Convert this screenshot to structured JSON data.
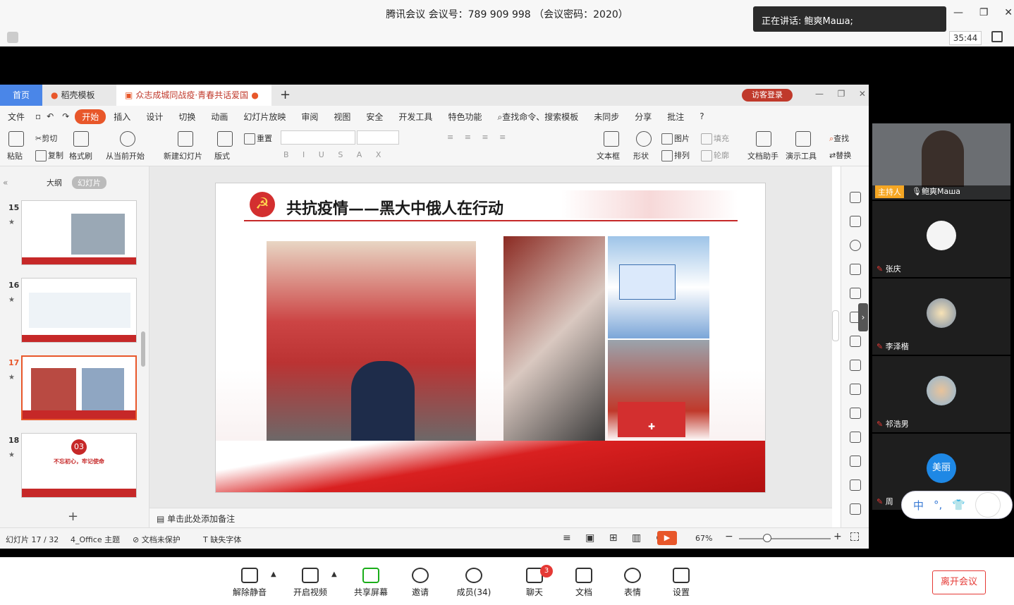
{
  "meeting": {
    "title": "腾讯会议 会议号：789 909 998 （会议密码：2020）",
    "speaking": "正在讲话: 鲍爽Маша;",
    "timer": "35:44"
  },
  "wps": {
    "tabs": [
      "首页",
      "稻壳模板",
      "众志成城同战疫·青春共话爱国情"
    ],
    "visitor": "访客登录",
    "menu": [
      "文件",
      "开始",
      "插入",
      "设计",
      "切换",
      "动画",
      "幻灯片放映",
      "审阅",
      "视图",
      "安全",
      "开发工具",
      "特色功能",
      "查找命令、搜索模板",
      "未同步",
      "分享",
      "批注"
    ],
    "ribbon": {
      "paste": "粘贴",
      "cut": "剪切",
      "copy": "复制",
      "format": "格式刷",
      "from_start": "从当前开始",
      "new_slide": "新建幻灯片",
      "layout": "版式",
      "reset": "重置",
      "textbox": "文本框",
      "shape": "形状",
      "picture": "图片",
      "fill": "填充",
      "arrange": "排列",
      "outline": "轮廓",
      "doc_helper": "文档助手",
      "present_tool": "演示工具",
      "find": "查找",
      "replace": "替换"
    },
    "panel_tabs": [
      "大纲",
      "幻灯片"
    ],
    "thumbs": [
      {
        "num": "15"
      },
      {
        "num": "16"
      },
      {
        "num": "17"
      },
      {
        "num": "18",
        "badge": "03",
        "caption": "不忘初心，牢记使命"
      }
    ],
    "slide_title": "共抗疫情——黑大中俄人在行动",
    "notes": "单击此处添加备注",
    "status": {
      "slide": "幻灯片 17 / 32",
      "theme": "4_Office 主题",
      "protect": "文档未保护",
      "font": "缺失字体",
      "zoom": "67%"
    }
  },
  "participants": [
    {
      "name": "鲍爽Маша",
      "role": "主持人"
    },
    {
      "name": "张庆"
    },
    {
      "name": "李泽楷"
    },
    {
      "name": "祁浩男"
    },
    {
      "name": "周",
      "avatar_text": "美丽"
    }
  ],
  "ime": {
    "lang": "中"
  },
  "bottom": {
    "items": [
      "解除静音",
      "开启视频",
      "共享屏幕",
      "邀请",
      "成员(34)",
      "聊天",
      "文档",
      "表情",
      "设置"
    ],
    "chat_badge": "3",
    "leave": "离开会议"
  }
}
